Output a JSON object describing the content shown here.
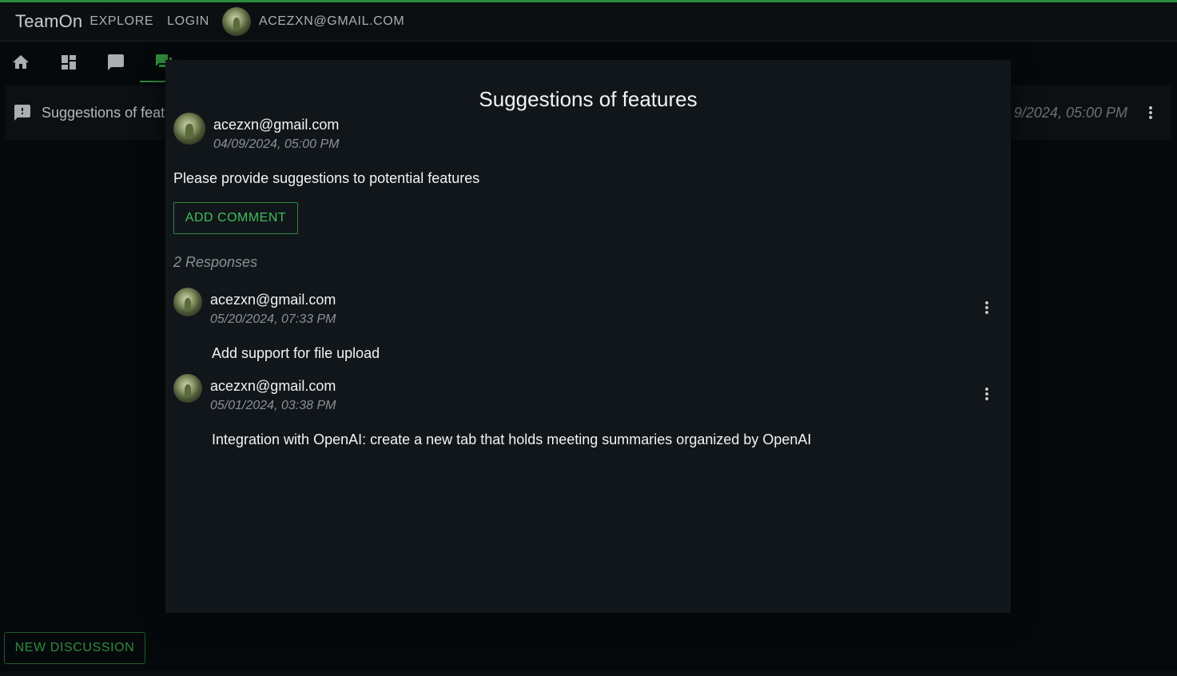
{
  "app": {
    "brand": "TeamOn",
    "nav": {
      "explore": "EXPLORE",
      "login": "LOGIN"
    },
    "user_email": "ACEZXN@GMAIL.COM",
    "accent_color": "#2e8b3e"
  },
  "tabs": [
    {
      "icon": "home-icon"
    },
    {
      "icon": "dashboard-icon"
    },
    {
      "icon": "chat-icon"
    },
    {
      "icon": "forum-icon",
      "active": true
    }
  ],
  "discussion_row": {
    "title": "Suggestions of feat",
    "date": "9/2024, 05:00 PM",
    "icon": "feedback-icon"
  },
  "new_discussion_label": "NEW DISCUSSION",
  "modal": {
    "title": "Suggestions of features",
    "author": "acezxn@gmail.com",
    "timestamp": "04/09/2024, 05:00 PM",
    "body": "Please provide suggestions to potential features",
    "add_comment_label": "ADD COMMENT",
    "responses_count": "2 Responses",
    "responses": [
      {
        "author": "acezxn@gmail.com",
        "timestamp": "05/20/2024, 07:33 PM",
        "text": "Add support for file upload"
      },
      {
        "author": "acezxn@gmail.com",
        "timestamp": "05/01/2024, 03:38 PM",
        "text": "Integration with OpenAI: create a new tab that holds meeting summaries organized by OpenAI"
      }
    ]
  }
}
